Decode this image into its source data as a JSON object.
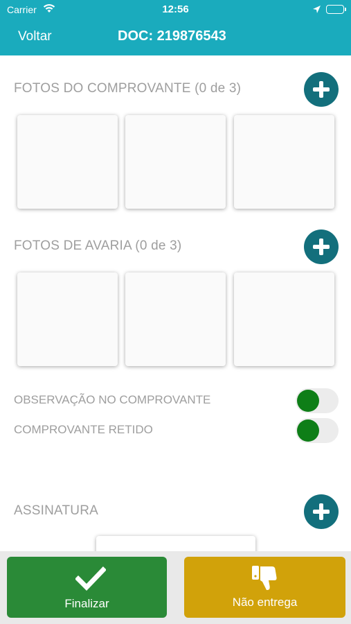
{
  "status_bar": {
    "carrier": "Carrier",
    "time": "12:56",
    "icons": [
      "wifi-icon",
      "location-arrow-icon",
      "battery-icon"
    ]
  },
  "nav": {
    "back_label": "Voltar",
    "title": "DOC: 219876543"
  },
  "sections": {
    "comprovante": {
      "title": "FOTOS DO COMPROVANTE (0 de 3)"
    },
    "avaria": {
      "title": "FOTOS DE AVARIA (0 de 3)"
    },
    "assinatura": {
      "title": "ASSINATURA"
    }
  },
  "toggles": {
    "observacao": {
      "label": "OBSERVAÇÃO NO COMPROVANTE",
      "on": false
    },
    "retido": {
      "label": "COMPROVANTE RETIDO",
      "on": false
    }
  },
  "actions": {
    "finalizar": {
      "label": "Finalizar",
      "icon": "checkmark-icon"
    },
    "nao_entrega": {
      "label": "Não entrega",
      "icon": "thumbs-down-icon"
    }
  },
  "colors": {
    "header": "#1aabbd",
    "add_button": "#136f7c",
    "toggle_knob": "#0e7e17",
    "finalizar": "#2a8a37",
    "nao_entrega": "#d1a20a"
  }
}
